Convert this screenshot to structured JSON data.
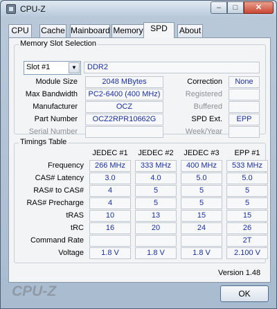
{
  "window": {
    "title": "CPU-Z",
    "minimize_glyph": "–",
    "maximize_glyph": "□",
    "close_glyph": "✕"
  },
  "tabs": [
    {
      "label": "CPU"
    },
    {
      "label": "Cache"
    },
    {
      "label": "Mainboard"
    },
    {
      "label": "Memory"
    },
    {
      "label": "SPD"
    },
    {
      "label": "About"
    }
  ],
  "memory_slot": {
    "legend": "Memory Slot Selection",
    "slot_selected": "Slot #1",
    "type": "DDR2",
    "module_size_label": "Module Size",
    "module_size": "2048 MBytes",
    "max_bandwidth_label": "Max Bandwidth",
    "max_bandwidth": "PC2-6400 (400 MHz)",
    "manufacturer_label": "Manufacturer",
    "manufacturer": "OCZ",
    "part_number_label": "Part Number",
    "part_number": "OCZ2RPR10662G",
    "serial_number_label": "Serial Number",
    "serial_number": "",
    "correction_label": "Correction",
    "correction": "None",
    "registered_label": "Registered",
    "registered": "",
    "buffered_label": "Buffered",
    "buffered": "",
    "spd_ext_label": "SPD Ext.",
    "spd_ext": "EPP",
    "week_year_label": "Week/Year",
    "week_year": ""
  },
  "timings": {
    "legend": "Timings Table",
    "columns": [
      "JEDEC #1",
      "JEDEC #2",
      "JEDEC #3",
      "EPP #1"
    ],
    "rows": [
      {
        "label": "Frequency",
        "values": [
          "266 MHz",
          "333 MHz",
          "400 MHz",
          "533 MHz"
        ]
      },
      {
        "label": "CAS# Latency",
        "values": [
          "3.0",
          "4.0",
          "5.0",
          "5.0"
        ]
      },
      {
        "label": "RAS# to CAS#",
        "values": [
          "4",
          "5",
          "5",
          "5"
        ]
      },
      {
        "label": "RAS# Precharge",
        "values": [
          "4",
          "5",
          "5",
          "5"
        ]
      },
      {
        "label": "tRAS",
        "values": [
          "10",
          "13",
          "15",
          "15"
        ]
      },
      {
        "label": "tRC",
        "values": [
          "16",
          "20",
          "24",
          "26"
        ]
      },
      {
        "label": "Command Rate",
        "values": [
          "",
          "",
          "",
          "2T"
        ]
      },
      {
        "label": "Voltage",
        "values": [
          "1.8 V",
          "1.8 V",
          "1.8 V",
          "2.100 V"
        ]
      }
    ]
  },
  "footer": {
    "version": "Version 1.48",
    "brand": "CPU-Z",
    "ok_label": "OK"
  }
}
